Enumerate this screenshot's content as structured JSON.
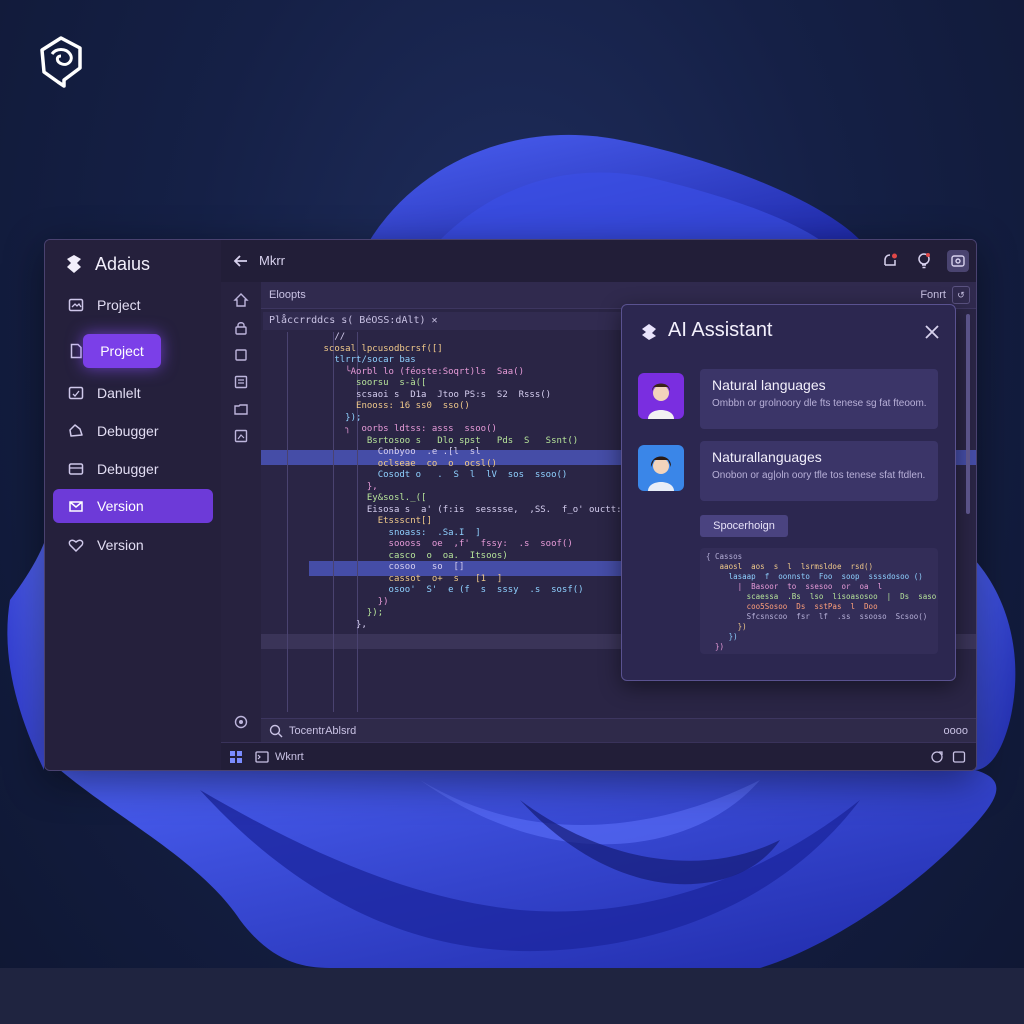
{
  "app": {
    "title": "Adaius"
  },
  "sidebar": {
    "items": [
      {
        "label": "Project",
        "icon": "image-icon"
      },
      {
        "label": "Project",
        "icon": "document-icon",
        "state": "active"
      },
      {
        "label": "Danlelt",
        "icon": "calendar-icon"
      },
      {
        "label": "Debugger",
        "icon": "cloud-icon"
      },
      {
        "label": "Debugger",
        "icon": "inbox-icon"
      },
      {
        "label": "Version",
        "icon": "mail-icon",
        "state": "selected"
      },
      {
        "label": "Version",
        "icon": "heart-icon"
      }
    ]
  },
  "topbar": {
    "title": "Mkrr",
    "icons": [
      "notification-icon",
      "bulb-icon",
      "settings-icon",
      "user-avatar"
    ]
  },
  "editor": {
    "toolbar_label": "Eloopts",
    "toolbar_right": "Fonrt",
    "toolbar_right_btn": "↺",
    "file_tab": "Plåccrrddcs s(  BéOSS:dAlt)  ✕",
    "code_lines": [
      "        //",
      "      scosal lpcusodbcrsf([]",
      "        tlrrt/socar bas",
      "          ╰Aorbl lo (féoste:Soqrt)ls  Saa()",
      "            soorsu  s-à([",
      "            scsaoi s  D1a  Jtoo PS:s  S2  Rsss()",
      "            Enooss: 16 ss0  sso()",
      "          });",
      "          ╮  oorbs ldtss: asss  ssoo()",
      "              Bsrtosoo s   Dlo spst   Pds  S   Ssnt()",
      "                Conbyoo  .e .[l  sl",
      "                oclseae  co  o  ocsl()",
      "                Cosodt o   .  S  l  lV  sos  ssoo()",
      "              },",
      "              Ey&sosl._([",
      "              Eisosa s  a' (f:is  sesssse,  ,SS.  f_o' ouctt:(f|[",
      "                Etssscnt[]",
      "                  snoass:  .Sa.I  ]",
      "                  soooss  oe  ,f'  fssy:  .s  soof()",
      "                  casco  o  oa.  Itsoos)",
      "                  cosoo   so  []",
      "                  cassot  o+  s   [1  ]",
      "                  osoo'  S'  e (f  s  sssy  .s  sosf()",
      "                })",
      "              });",
      "            },"
    ]
  },
  "assistant": {
    "title": "AI Assistant",
    "messages": [
      {
        "title": "Natural languages",
        "body": "Ombbn  or grolnoory  dle  fts  tenese  sg  fat  fteoom."
      },
      {
        "title": "Naturallanguages",
        "body": "Onobon  or  ag|oln  oory  tfle  tos  tenese  sfat  ftdlen."
      }
    ],
    "suggestion_button": "Spocerhoign",
    "mini_code": [
      "{ Cassos",
      "   aaosl  aos  s  l  lsrmsldoe  rsd()",
      "     lasaap  f  oonnsto  Foo  soop  ssssdosoo ()",
      "       |  Basoor  to  ssesoo  or  oa  l",
      "         scaessa  .Bs  lso  lisoasosoo  |  Ds  saso",
      "         coo5Sosoo  Ds  sstPas  l  Doo",
      "         Sfcsnscoo  fsr  lf  .ss  ssooso  Scsoo()",
      "       })",
      "     })",
      "  })"
    ]
  },
  "searchbar": {
    "placeholder": "TocentrAblsrd",
    "right_label": "oooo"
  },
  "statusbar": {
    "label": "Wknrt"
  },
  "colors": {
    "accent": "#7b3fe8",
    "window_bg": "#231f3a",
    "page_bg": "#152046",
    "bloom": "#3747d8",
    "highlight": "#4a55b8"
  }
}
